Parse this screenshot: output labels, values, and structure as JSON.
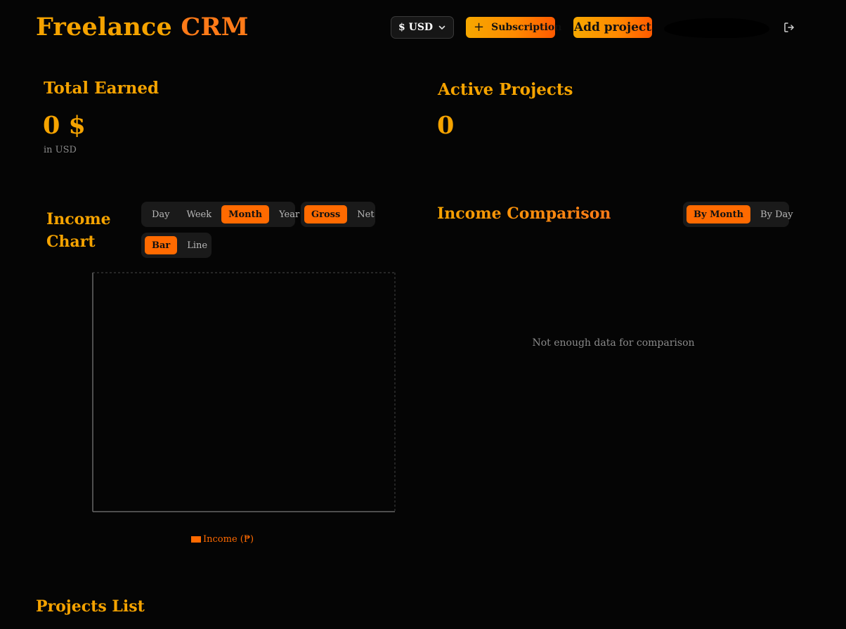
{
  "header": {
    "brand_part1": "Freelance",
    "brand_part2": "CRM",
    "currency": "$ USD",
    "subscription_label": "Subscription",
    "add_project_label": "Add project"
  },
  "stats": {
    "total_earned_title": "Total Earned",
    "total_earned_value": "0 $",
    "total_earned_sub": "in USD",
    "active_projects_title": "Active Projects",
    "active_projects_value": "0"
  },
  "income_chart": {
    "title": "Income Chart",
    "period_options": [
      "Day",
      "Week",
      "Month",
      "Year"
    ],
    "period_active": "Month",
    "mode_options": [
      "Gross",
      "Net"
    ],
    "mode_active": "Gross",
    "type_options": [
      "Bar",
      "Line"
    ],
    "type_active": "Bar",
    "legend": "Income (₱)"
  },
  "comparison": {
    "title": "Income Comparison",
    "options": [
      "By Month",
      "By Day"
    ],
    "active": "By Month",
    "empty_message": "Not enough data for comparison"
  },
  "projects": {
    "title": "Projects List"
  },
  "colors": {
    "accent_orange": "#ff6a00",
    "accent_gold": "#f5a300",
    "background": "#050505"
  }
}
